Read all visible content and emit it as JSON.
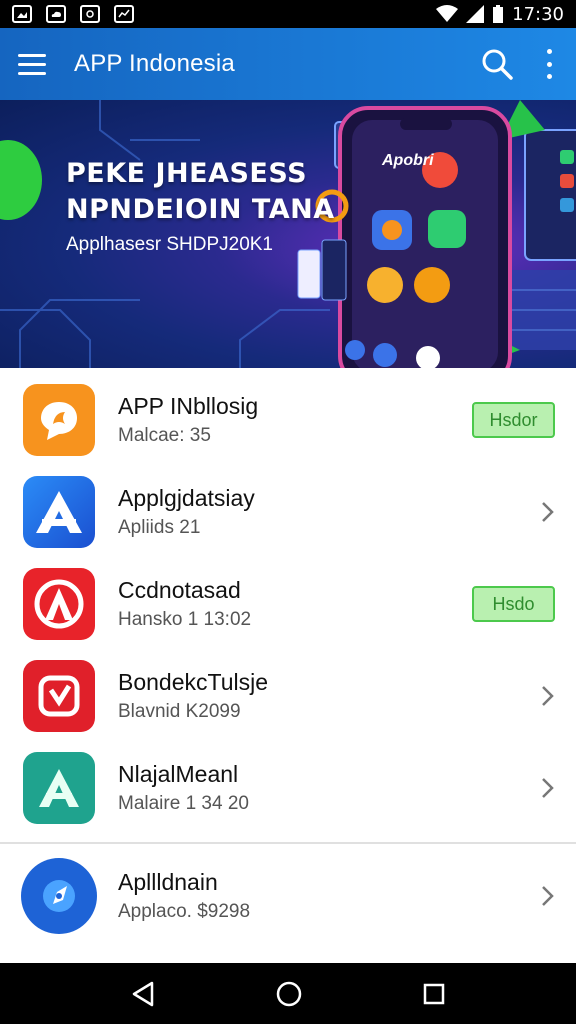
{
  "status_bar": {
    "time": "17:30"
  },
  "app_bar": {
    "title": "APP Indonesia"
  },
  "banner": {
    "title_line1": "PEKE JHEASESS",
    "title_line2": "NPNDEIOIN TANA",
    "subtitle": "Applhasesr SHDPJ20K1",
    "phone_label": "Apobri"
  },
  "apps": [
    {
      "name": "APP INbllosig",
      "meta": "Malcae: 35",
      "action": "Hsdor",
      "icon_color": "#f7931e",
      "icon": "chat-bubble-icon"
    },
    {
      "name": "Applgjdatsiay",
      "meta": "Apliids 21",
      "action": "",
      "icon_color": "#1e6fd9",
      "icon": "letter-a-icon"
    },
    {
      "name": "Ccdnotasad",
      "meta": "Hansko 1 13:02",
      "action": "Hsdo",
      "icon_color": "#e8232a",
      "icon": "letter-a-icon"
    },
    {
      "name": "BondekcTulsje",
      "meta": "Blavnid K2099",
      "action": "",
      "icon_color": "#e0202a",
      "icon": "shield-icon"
    },
    {
      "name": "NlajalMeanl",
      "meta": "Malaire 1 34 20",
      "action": "",
      "icon_color": "#1fa38e",
      "icon": "letter-a-icon"
    },
    {
      "name": "Apllldnain",
      "meta": "Applaco. $9298",
      "action": "",
      "icon_color": "#1e63d6",
      "icon": "compass-icon"
    }
  ],
  "colors": {
    "app_bar": "#1565c0",
    "get_button": "#b9f0b0",
    "get_button_border": "#4cc94c"
  }
}
